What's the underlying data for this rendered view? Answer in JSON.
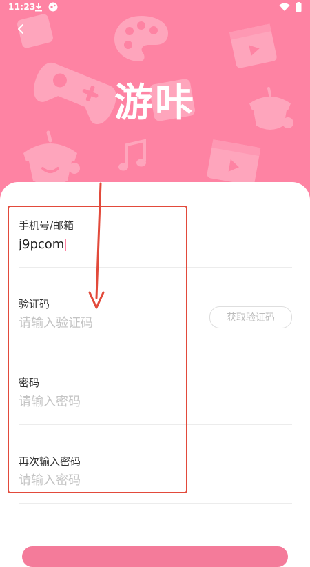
{
  "status_bar": {
    "time": "11:23",
    "left_icons": [
      "download-icon",
      "game-notification-icon"
    ],
    "right_icons": [
      "wifi-icon",
      "battery-icon"
    ]
  },
  "header": {
    "back_icon": "chevron-left-icon",
    "app_title": "游咔",
    "decorations": [
      "photo-icon",
      "palette-icon",
      "video-icon",
      "gamepad-icon",
      "acorn-icon",
      "music-note-icon",
      "video-icon"
    ]
  },
  "form": {
    "account": {
      "label": "手机号/邮箱",
      "value": "j9pcom",
      "placeholder": ""
    },
    "code": {
      "label": "验证码",
      "value": "",
      "placeholder": "请输入验证码",
      "button": "获取验证码"
    },
    "password": {
      "label": "密码",
      "value": "",
      "placeholder": "请输入密码"
    },
    "confirm_password": {
      "label": "再次输入密码",
      "value": "",
      "placeholder": "请输入密码"
    }
  },
  "colors": {
    "brand": "#fe83a3",
    "annotation": "#e24a3b"
  }
}
